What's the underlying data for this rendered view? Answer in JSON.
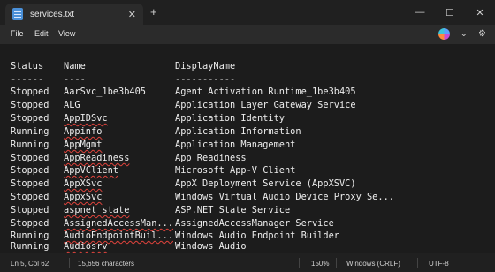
{
  "window": {
    "tab_title": "services.txt",
    "tab_close": "✕",
    "new_tab": "+",
    "minimize": "—",
    "maximize": "☐",
    "close": "✕"
  },
  "menu": {
    "file": "File",
    "edit": "Edit",
    "view": "View",
    "settings": "⚙"
  },
  "table": {
    "headers": {
      "status": "Status",
      "name": "Name",
      "display": "DisplayName"
    },
    "dashes": {
      "status": "------",
      "name": "----",
      "display": "-----------"
    },
    "rows": [
      {
        "status": "Stopped",
        "name": "AarSvc_1be3b405",
        "display": "Agent Activation Runtime_1be3b405"
      },
      {
        "status": "Stopped",
        "name": "ALG",
        "display": "Application Layer Gateway Service"
      },
      {
        "status": "Stopped",
        "name": "AppIDSvc",
        "display": "Application Identity"
      },
      {
        "status": "Running",
        "name": "Appinfo",
        "display": "Application Information"
      },
      {
        "status": "Running",
        "name": "AppMgmt",
        "display": "Application Management"
      },
      {
        "status": "Stopped",
        "name": "AppReadiness",
        "display": "App Readiness"
      },
      {
        "status": "Stopped",
        "name": "AppVClient",
        "display": "Microsoft App-V Client"
      },
      {
        "status": "Stopped",
        "name": "AppXSvc",
        "display": "AppX Deployment Service (AppXSVC)"
      },
      {
        "status": "Stopped",
        "name": "AppxSvc",
        "display": "Windows Virtual Audio Device Proxy Se..."
      },
      {
        "status": "Stopped",
        "name": "aspnet_state",
        "display": "ASP.NET State Service"
      },
      {
        "status": "Stopped",
        "name": "AssignedAccessMan...",
        "display": "AssignedAccessManager Service"
      },
      {
        "status": "Running",
        "name": "AudioEndpointBuil...",
        "display": "Windows Audio Endpoint Builder"
      },
      {
        "status": "Running",
        "name": "Audiosrv",
        "display": "Windows Audio"
      }
    ]
  },
  "status": {
    "position": "Ln 5, Col 62",
    "characters": "15,656 characters",
    "zoom": "150%",
    "line_ending": "Windows (CRLF)",
    "encoding": "UTF-8"
  }
}
